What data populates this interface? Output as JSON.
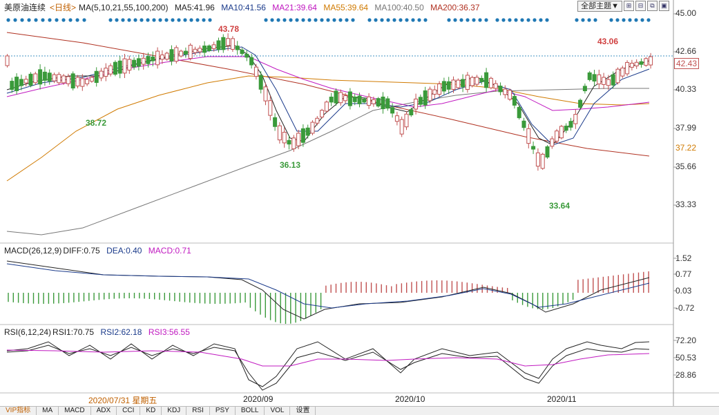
{
  "header": {
    "instrument": "美原油连续",
    "period": "<日线>",
    "ma_label": "MA(5,10,21,55,100,200)",
    "ma": [
      {
        "label": "MA5:41.96",
        "color": "#222222"
      },
      {
        "label": "MA10:41.56",
        "color": "#1a3a8a"
      },
      {
        "label": "MA21:39.64",
        "color": "#c018c0"
      },
      {
        "label": "MA55:39.64",
        "color": "#d07a00"
      },
      {
        "label": "MA100:40.50",
        "color": "#777777"
      },
      {
        "label": "MA200:36.37",
        "color": "#b03020"
      }
    ],
    "theme_button": "全部主题▼"
  },
  "price_axis": [
    "45.00",
    "42.66",
    "40.33",
    "37.99",
    "35.66",
    "33.33"
  ],
  "price_tags": {
    "current": "42.43",
    "ma_tag": "37.22"
  },
  "highlights": [
    {
      "label": "43.78",
      "color": "#d04040"
    },
    {
      "label": "38.72",
      "color": "#3a9a3a"
    },
    {
      "label": "36.13",
      "color": "#3a9a3a"
    },
    {
      "label": "43.06",
      "color": "#d04040"
    },
    {
      "label": "33.64",
      "color": "#3a9a3a"
    }
  ],
  "macd": {
    "title": "MACD(26,12,9)",
    "diff": "DIFF:0.75",
    "dea": "DEA:0.40",
    "macd": "MACD:0.71",
    "axis": [
      "1.52",
      "0.77",
      "0.03",
      "-0.72"
    ]
  },
  "rsi": {
    "title": "RSI(6,12,24)",
    "rsi1": "RSI1:70.75",
    "rsi2": "RSI2:62.18",
    "rsi3": "RSI3:56.55",
    "axis": [
      "72.20",
      "50.53",
      "28.86"
    ]
  },
  "x_axis": {
    "cursor_date": "2020/07/31 星期五",
    "months": [
      "2020/09",
      "2020/10",
      "2020/11"
    ]
  },
  "tabs": [
    "VIP指标",
    "MA",
    "MACD",
    "ADX",
    "CCI",
    "KD",
    "KDJ",
    "RSI",
    "PSY",
    "BOLL",
    "VOL",
    "设置"
  ],
  "colors": {
    "up": "#c05050",
    "down": "#3a9a3a",
    "cursor_date": "#c06000"
  }
}
